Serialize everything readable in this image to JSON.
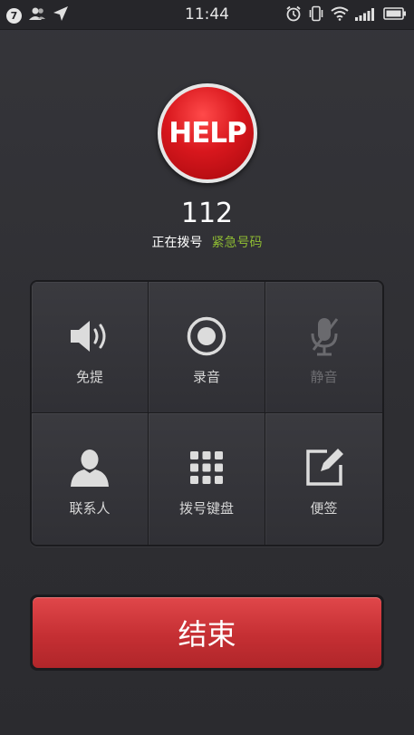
{
  "status_bar": {
    "notification_count": "7",
    "time": "11:44",
    "icons": [
      "contacts-icon",
      "location-arrow-icon",
      "alarm-icon",
      "vibrate-icon",
      "wifi-icon",
      "signal-icon",
      "battery-icon"
    ]
  },
  "call": {
    "badge_text": "HELP",
    "number": "112",
    "status": "正在拨号",
    "type_label": "紧急号码"
  },
  "controls": [
    {
      "label": "免提",
      "icon": "speaker-icon",
      "enabled": true
    },
    {
      "label": "录音",
      "icon": "record-icon",
      "enabled": true
    },
    {
      "label": "静音",
      "icon": "mute-icon",
      "enabled": false
    },
    {
      "label": "联系人",
      "icon": "contact-person-icon",
      "enabled": true
    },
    {
      "label": "拨号键盘",
      "icon": "keypad-icon",
      "enabled": true
    },
    {
      "label": "便签",
      "icon": "note-edit-icon",
      "enabled": true
    }
  ],
  "end_button": {
    "label": "结束"
  },
  "colors": {
    "background": "#2f2f33",
    "accent_green": "#8cb833",
    "end_red": "#c52f33",
    "help_red": "#d8171d"
  }
}
